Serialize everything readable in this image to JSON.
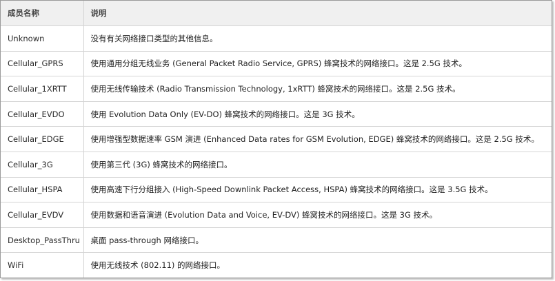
{
  "table": {
    "headers": [
      "成员名称",
      "说明"
    ],
    "rows": [
      {
        "name": "Unknown",
        "description": "没有有关网络接口类型的其他信息。"
      },
      {
        "name": "Cellular_GPRS",
        "description": "使用通用分组无线业务 (General Packet Radio Service, GPRS) 蜂窝技术的网络接口。这是 2.5G 技术。"
      },
      {
        "name": "Cellular_1XRTT",
        "description": "使用无线传输技术 (Radio Transmission Technology, 1xRTT) 蜂窝技术的网络接口。这是 2.5G 技术。"
      },
      {
        "name": "Cellular_EVDO",
        "description": "使用 Evolution Data Only (EV-DO) 蜂窝技术的网络接口。这是 3G 技术。"
      },
      {
        "name": "Cellular_EDGE",
        "description": "使用增强型数据速率 GSM 演进 (Enhanced Data rates for GSM Evolution, EDGE) 蜂窝技术的网络接口。这是 2.5G 技术。"
      },
      {
        "name": "Cellular_3G",
        "description": "使用第三代 (3G) 蜂窝技术的网络接口。"
      },
      {
        "name": "Cellular_HSPA",
        "description": "使用高速下行分组接入 (High-Speed Downlink Packet Access, HSPA) 蜂窝技术的网络接口。这是 3.5G 技术。"
      },
      {
        "name": "Cellular_EVDV",
        "description": "使用数据和语音演进 (Evolution Data and Voice, EV-DV) 蜂窝技术的网络接口。这是 3G 技术。"
      },
      {
        "name": "Desktop_PassThru",
        "description": "桌面 pass-through 网络接口。"
      },
      {
        "name": "WiFi",
        "description": "使用无线技术 (802.11) 的网络接口。"
      }
    ]
  },
  "colors": {
    "header_bg": "#f0f0f0",
    "border": "#d4d4d4",
    "frame_border": "#9a9a9a"
  }
}
